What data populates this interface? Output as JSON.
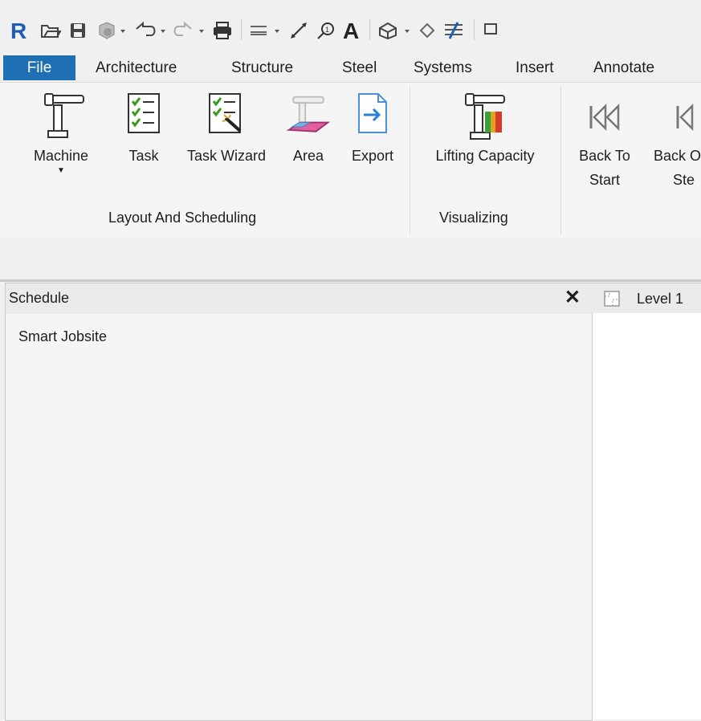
{
  "qat": {
    "icons": [
      "revit-logo-icon",
      "open-folder-icon",
      "save-icon",
      "sync-icon",
      "undo-icon",
      "redo-icon",
      "print-icon",
      "measure-icon",
      "dimension-icon",
      "tag-icon",
      "text-icon",
      "3d-view-icon",
      "section-icon",
      "thin-lines-icon",
      "switch-windows-icon"
    ]
  },
  "tabs": [
    "File",
    "Architecture",
    "Structure",
    "Steel",
    "Systems",
    "Insert",
    "Annotate"
  ],
  "ribbon": {
    "machine": "Machine",
    "task": "Task",
    "task_wizard": "Task Wizard",
    "area": "Area",
    "export": "Export",
    "lifting_capacity": "Lifting Capacity",
    "back_to_start_1": "Back To",
    "back_to_start_2": "Start",
    "back_step_1": "Back O",
    "back_step_2": "Ste",
    "panel_layout": "Layout And Scheduling",
    "panel_visualizing": "Visualizing"
  },
  "schedule": {
    "title": "Schedule",
    "close": "✕",
    "item": "Smart Jobsite"
  },
  "view": {
    "tab_label": "Level 1"
  },
  "colors": {
    "file_tab": "#1f6fb4",
    "revit_logo": "#1a5fb4"
  }
}
